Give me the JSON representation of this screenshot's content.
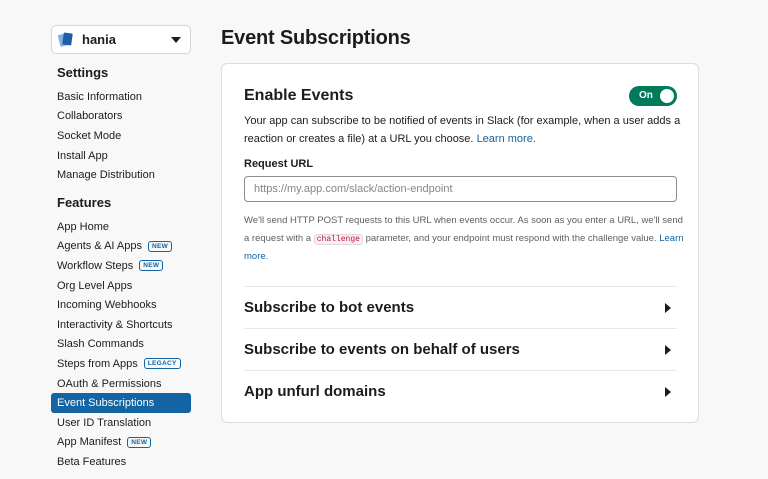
{
  "app_selector": {
    "name": "hania"
  },
  "sidebar": {
    "settings_heading": "Settings",
    "settings_items": [
      {
        "label": "Basic Information"
      },
      {
        "label": "Collaborators"
      },
      {
        "label": "Socket Mode"
      },
      {
        "label": "Install App"
      },
      {
        "label": "Manage Distribution"
      }
    ],
    "features_heading": "Features",
    "features_items": [
      {
        "label": "App Home"
      },
      {
        "label": "Agents & AI Apps",
        "badge": "NEW"
      },
      {
        "label": "Workflow Steps",
        "badge": "NEW"
      },
      {
        "label": "Org Level Apps"
      },
      {
        "label": "Incoming Webhooks"
      },
      {
        "label": "Interactivity & Shortcuts"
      },
      {
        "label": "Slash Commands"
      },
      {
        "label": "Steps from Apps",
        "badge": "LEGACY"
      },
      {
        "label": "OAuth & Permissions"
      },
      {
        "label": "Event Subscriptions",
        "active": true
      },
      {
        "label": "User ID Translation"
      },
      {
        "label": "App Manifest",
        "badge": "NEW"
      },
      {
        "label": "Beta Features"
      }
    ]
  },
  "main": {
    "title": "Event Subscriptions",
    "enable_events": {
      "title": "Enable Events",
      "toggle_label": "On",
      "description": "Your app can subscribe to be notified of events in Slack (for example, when a user adds a reaction or creates a file) at a URL you choose.",
      "learn_more": "Learn more."
    },
    "request_url": {
      "label": "Request URL",
      "placeholder": "https://my.app.com/slack/action-endpoint",
      "value": "",
      "help_before": "We'll send HTTP POST requests to this URL when events occur. As soon as you enter a URL, we'll send a request with a",
      "help_code": "challenge",
      "help_after": "parameter, and your endpoint must respond with the challenge value.",
      "learn_more": "Learn more."
    },
    "sections": [
      {
        "label": "Subscribe to bot events"
      },
      {
        "label": "Subscribe to events on behalf of users"
      },
      {
        "label": "App unfurl domains"
      }
    ]
  }
}
